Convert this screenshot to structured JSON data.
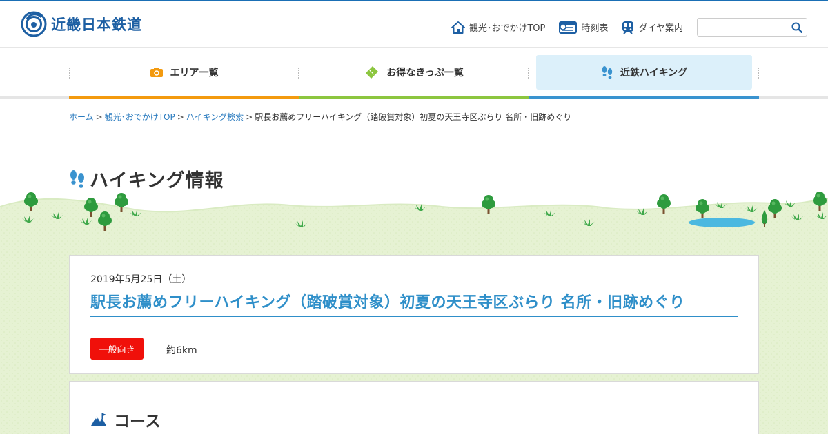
{
  "brand": {
    "name": "近畿日本鉄道"
  },
  "util_nav": [
    {
      "label": "観光･おでかけTOP",
      "icon": "house-icon"
    },
    {
      "label": "時刻表",
      "icon": "timetable-icon"
    },
    {
      "label": "ダイヤ案内",
      "icon": "train-icon"
    }
  ],
  "search": {
    "placeholder": ""
  },
  "global_nav": [
    {
      "label": "エリア一覧",
      "icon": "camera-icon",
      "color": "#f39a0f"
    },
    {
      "label": "お得なきっぷ一覧",
      "icon": "ticket-icon",
      "color": "#8cc63f"
    },
    {
      "label": "近鉄ハイキング",
      "icon": "footprints-icon",
      "color": "#3a93cf",
      "active": true
    }
  ],
  "breadcrumb": {
    "items": [
      "ホーム",
      "観光･おでかけTOP",
      "ハイキング検索"
    ],
    "separator": ">",
    "current": "駅長お薦めフリーハイキング（踏破賞対象）初夏の天王寺区ぶらり 名所・旧跡めぐり"
  },
  "page": {
    "title": "ハイキング情報"
  },
  "event": {
    "date": "2019年5月25日（土）",
    "title": "駅長お薦めフリーハイキング（踏破賞対象）初夏の天王寺区ぶらり 名所・旧跡めぐり",
    "level": "一般向き",
    "distance": "約6km"
  },
  "course": {
    "heading": "コース"
  },
  "colors": {
    "brand": "#1d5fa3",
    "link": "#2a7bbf",
    "event_title": "#2f8fc9",
    "badge": "#f0100a",
    "grass": "#e5f2d2",
    "active_tab_bg": "#dcf0fa"
  }
}
